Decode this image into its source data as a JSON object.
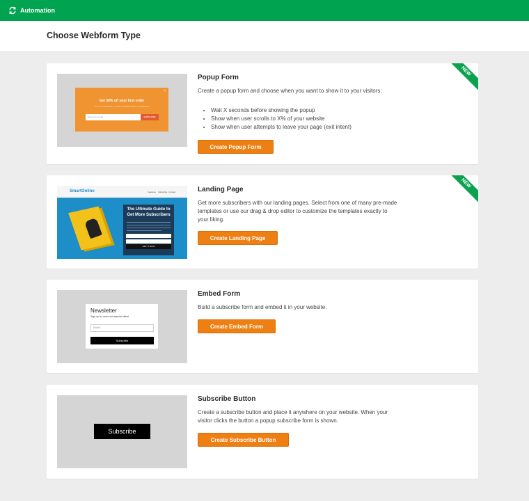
{
  "topbar": {
    "title": "Automation",
    "color": "#00a450"
  },
  "header": {
    "title": "Choose Webform Type"
  },
  "cards": [
    {
      "title": "Popup Form",
      "badge": "NEW",
      "description": "Create a popup form and choose when you want to show it to your visitors:",
      "bullets": [
        "Wait X seconds before showing the popup",
        "Show when user scrolls to X% of your website",
        "Show when user attempts to leave your page (exit intent)"
      ],
      "button": "Create Popup Form",
      "preview": {
        "headline": "Get 30% off your first order",
        "subtext": "Join our newsletter to receive exclusive offers and updates",
        "input_placeholder": "Enter your email",
        "button": "SUBSCRIBE",
        "close": "×"
      }
    },
    {
      "title": "Landing Page",
      "badge": "NEW",
      "description": "Get more subscribers with our landing pages. Select from one of many pre-made templates or use our drag & drop editor to customize the templates exactly to your liking.",
      "button": "Create Landing Page",
      "preview": {
        "logo": "SmartOnline",
        "nav": [
          "Features",
          "Subscribe",
          "Contact"
        ],
        "headline": "The Ultimate Guide to Get More Subscribers",
        "field1": "Name",
        "field2": "Email",
        "button": "GET IT NOW"
      }
    },
    {
      "title": "Embed Form",
      "description": "Build a subscribe form and embed it in your website.",
      "button": "Create Embed Form",
      "preview": {
        "title": "Newsletter",
        "subtitle": "Sign up for news and special offers!",
        "input_placeholder": "Email*",
        "button": "Subscribe"
      }
    },
    {
      "title": "Subscribe Button",
      "description": "Create a subscribe button and place it anywhere on your website. When your visitor clicks the button a popup subscribe form is shown.",
      "button": "Create Subscribe Button",
      "preview": {
        "button": "Subscribe"
      }
    }
  ],
  "colors": {
    "accent": "#ee7f12",
    "green": "#00a450",
    "background": "#ededed"
  }
}
